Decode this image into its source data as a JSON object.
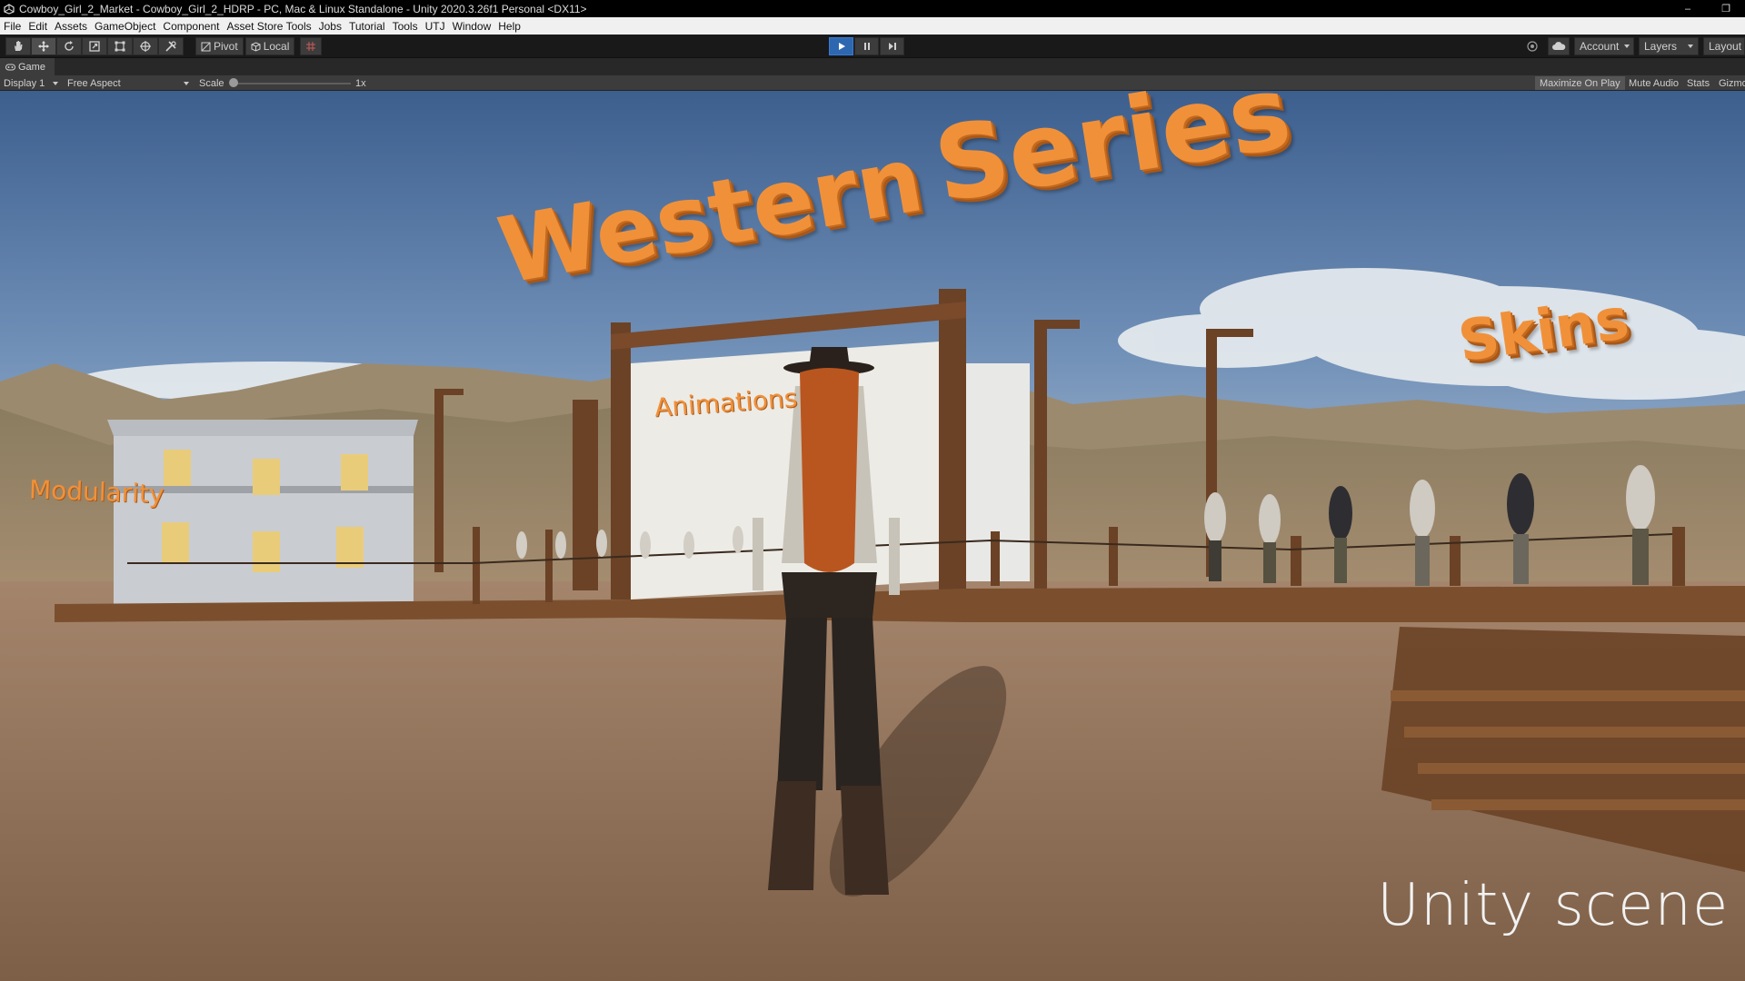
{
  "window": {
    "title": "Cowboy_Girl_2_Market - Cowboy_Girl_2_HDRP - PC, Mac & Linux Standalone - Unity 2020.3.26f1 Personal <DX11>",
    "minimize_glyph": "–",
    "restore_glyph": "❐"
  },
  "menu": [
    "File",
    "Edit",
    "Assets",
    "GameObject",
    "Component",
    "Asset Store Tools",
    "Jobs",
    "Tutorial",
    "Tools",
    "UTJ",
    "Window",
    "Help"
  ],
  "toolbar": {
    "tools": [
      "hand-tool-icon",
      "move-tool-icon",
      "rotate-tool-icon",
      "scale-tool-icon",
      "rect-tool-icon",
      "transform-tool-icon",
      "custom-tool-icon"
    ],
    "active_tool": "move-tool-icon",
    "pivot_label": "Pivot",
    "local_label": "Local",
    "account_label": "Account",
    "layers_label": "Layers",
    "layout_label": "Layout",
    "play_active": true,
    "accent_color": "#2d67b0"
  },
  "game_view": {
    "tab_label": "Game",
    "display_label": "Display 1",
    "aspect_label": "Free Aspect",
    "scale_label": "Scale",
    "scale_value": "1x",
    "maximize_label": "Maximize On Play",
    "mute_label": "Mute Audio",
    "stats_label": "Stats",
    "gizmos_label": "Gizmos"
  },
  "scene": {
    "title_word_1": "Western",
    "title_word_2": "Series",
    "skins_label": "Skins",
    "modularity_label": "Modularity",
    "animations_label": "Animations",
    "caption": "Unity scene",
    "title_color": "#f0913a"
  }
}
